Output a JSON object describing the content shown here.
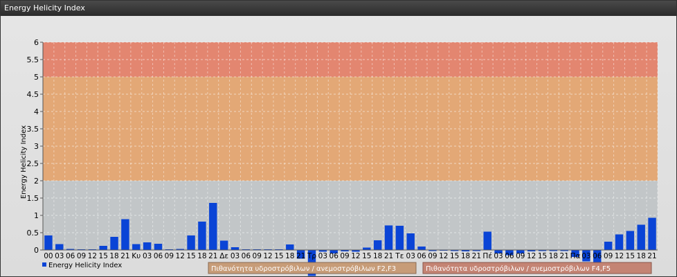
{
  "window": {
    "title": "Energy Helicity Index"
  },
  "chart_data": {
    "type": "bar",
    "ylabel": "Energy Helicity Index",
    "ylim": [
      0,
      6
    ],
    "yticks": [
      "0",
      "0.5",
      "1",
      "1.5",
      "2",
      "2.5",
      "3",
      "3.5",
      "4",
      "4.5",
      "5",
      "5.5",
      "6"
    ],
    "zones": [
      {
        "from": 0,
        "to": 2,
        "color": "#c2c6c8"
      },
      {
        "from": 2,
        "to": 5,
        "color": "#e3a876"
      },
      {
        "from": 5,
        "to": 6,
        "color": "#e38670"
      }
    ],
    "categories": [
      "00",
      "03",
      "06",
      "09",
      "12",
      "15",
      "18",
      "21",
      "Κυ",
      "03",
      "06",
      "09",
      "12",
      "15",
      "18",
      "21",
      "Δε",
      "03",
      "06",
      "09",
      "12",
      "15",
      "18",
      "21",
      "Τρ",
      "03",
      "06",
      "09",
      "12",
      "15",
      "18",
      "21",
      "Τε",
      "03",
      "06",
      "09",
      "12",
      "15",
      "18",
      "21",
      "Πέ",
      "03",
      "06",
      "09",
      "12",
      "15",
      "18",
      "21",
      "Πα",
      "03",
      "06",
      "09",
      "12",
      "15",
      "18",
      "21"
    ],
    "series": [
      {
        "name": "Energy Helicity Index",
        "color": "#0a44d6",
        "values": [
          0.42,
          0.17,
          0.03,
          0.02,
          0.02,
          0.12,
          0.38,
          0.89,
          0.17,
          0.22,
          0.18,
          0.02,
          0.03,
          0.42,
          0.82,
          1.36,
          0.27,
          0.08,
          0.02,
          0.02,
          0.02,
          0.02,
          0.16,
          -0.25,
          -0.75,
          -0.05,
          -0.1,
          -0.04,
          -0.05,
          0.07,
          0.28,
          0.71,
          0.7,
          0.48,
          0.1,
          -0.03,
          -0.02,
          -0.03,
          -0.04,
          -0.03,
          0.53,
          -0.1,
          -0.15,
          -0.1,
          -0.04,
          -0.03,
          -0.03,
          -0.03,
          -0.2,
          -0.33,
          -0.4,
          0.24,
          0.45,
          0.55,
          0.73,
          0.93
        ]
      }
    ],
    "legend": {
      "series_label": "Energy Helicity Index",
      "placement": "bottom-left"
    },
    "probability_legend": [
      {
        "label": "Πιθανότητα υδροστρόβιλων / ανεμοστρόβιλων F2,F3",
        "color": "#c79c78"
      },
      {
        "label": "Πιθανότητα υδροστρόβιλων / ανεμοστρόβιλων F4,F5",
        "color": "#c48474"
      }
    ]
  }
}
